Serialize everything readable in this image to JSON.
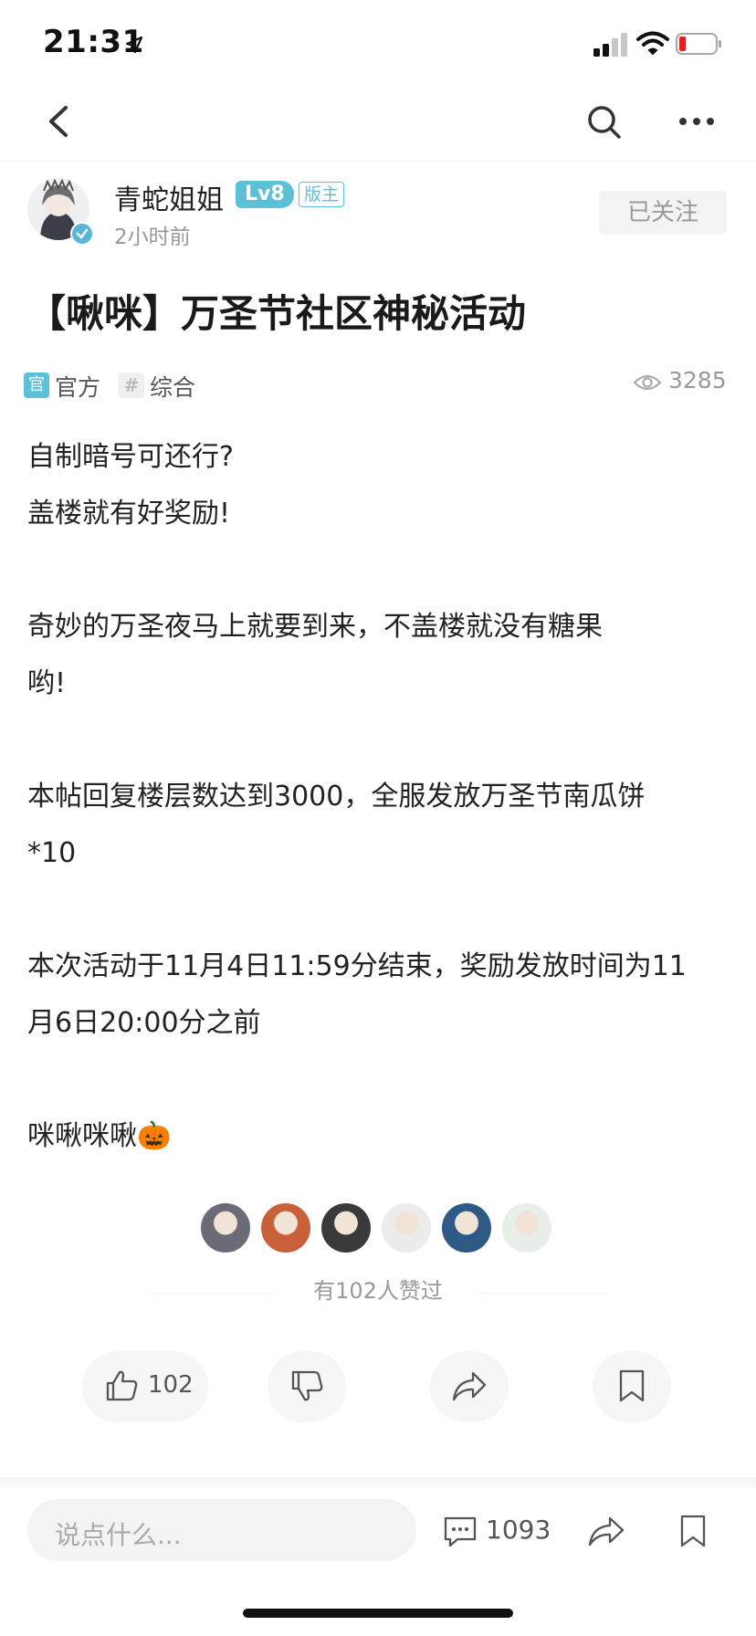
{
  "status_bar": {
    "time": "21:31"
  },
  "nav": {
    "back": "back-icon",
    "search": "search-icon",
    "more": "more-icon"
  },
  "author": {
    "name": "青蛇姐姐",
    "level": "Lv8",
    "role_badge": "版主",
    "time_ago": "2小时前",
    "follow_label": "已关注"
  },
  "post": {
    "title": "【啾咪】万圣节社区神秘活动",
    "tags": [
      {
        "icon_text": "官",
        "label": "官方"
      },
      {
        "icon_text": "#",
        "label": "综合"
      }
    ],
    "views": "3285",
    "paragraphs": [
      "自制暗号可还行?\n盖楼就有好奖励!",
      "奇妙的万圣夜马上就要到来，不盖楼就没有糖果\n哟!",
      "本帖回复楼层数达到3000，全服发放万圣节南瓜饼\n*10",
      "本次活动于11月4日11:59分结束，奖励发放时间为11\n月6日20:00分之前",
      "咪啾咪啾🎃"
    ]
  },
  "likes": {
    "summary": "有102人赞过",
    "liker_avatar_colors": [
      "#6b6b78",
      "#c8603a",
      "#3a3a3a",
      "#ececec",
      "#2f5a86",
      "#e8eee8"
    ]
  },
  "actions": {
    "like_count": "102",
    "icons": [
      "thumbs-up-icon",
      "thumbs-down-icon",
      "share-icon",
      "bookmark-icon"
    ]
  },
  "bottom_bar": {
    "comment_placeholder": "说点什么...",
    "comment_count": "1093"
  },
  "colors": {
    "accent": "#5cc0d6",
    "muted_text": "#999999"
  }
}
